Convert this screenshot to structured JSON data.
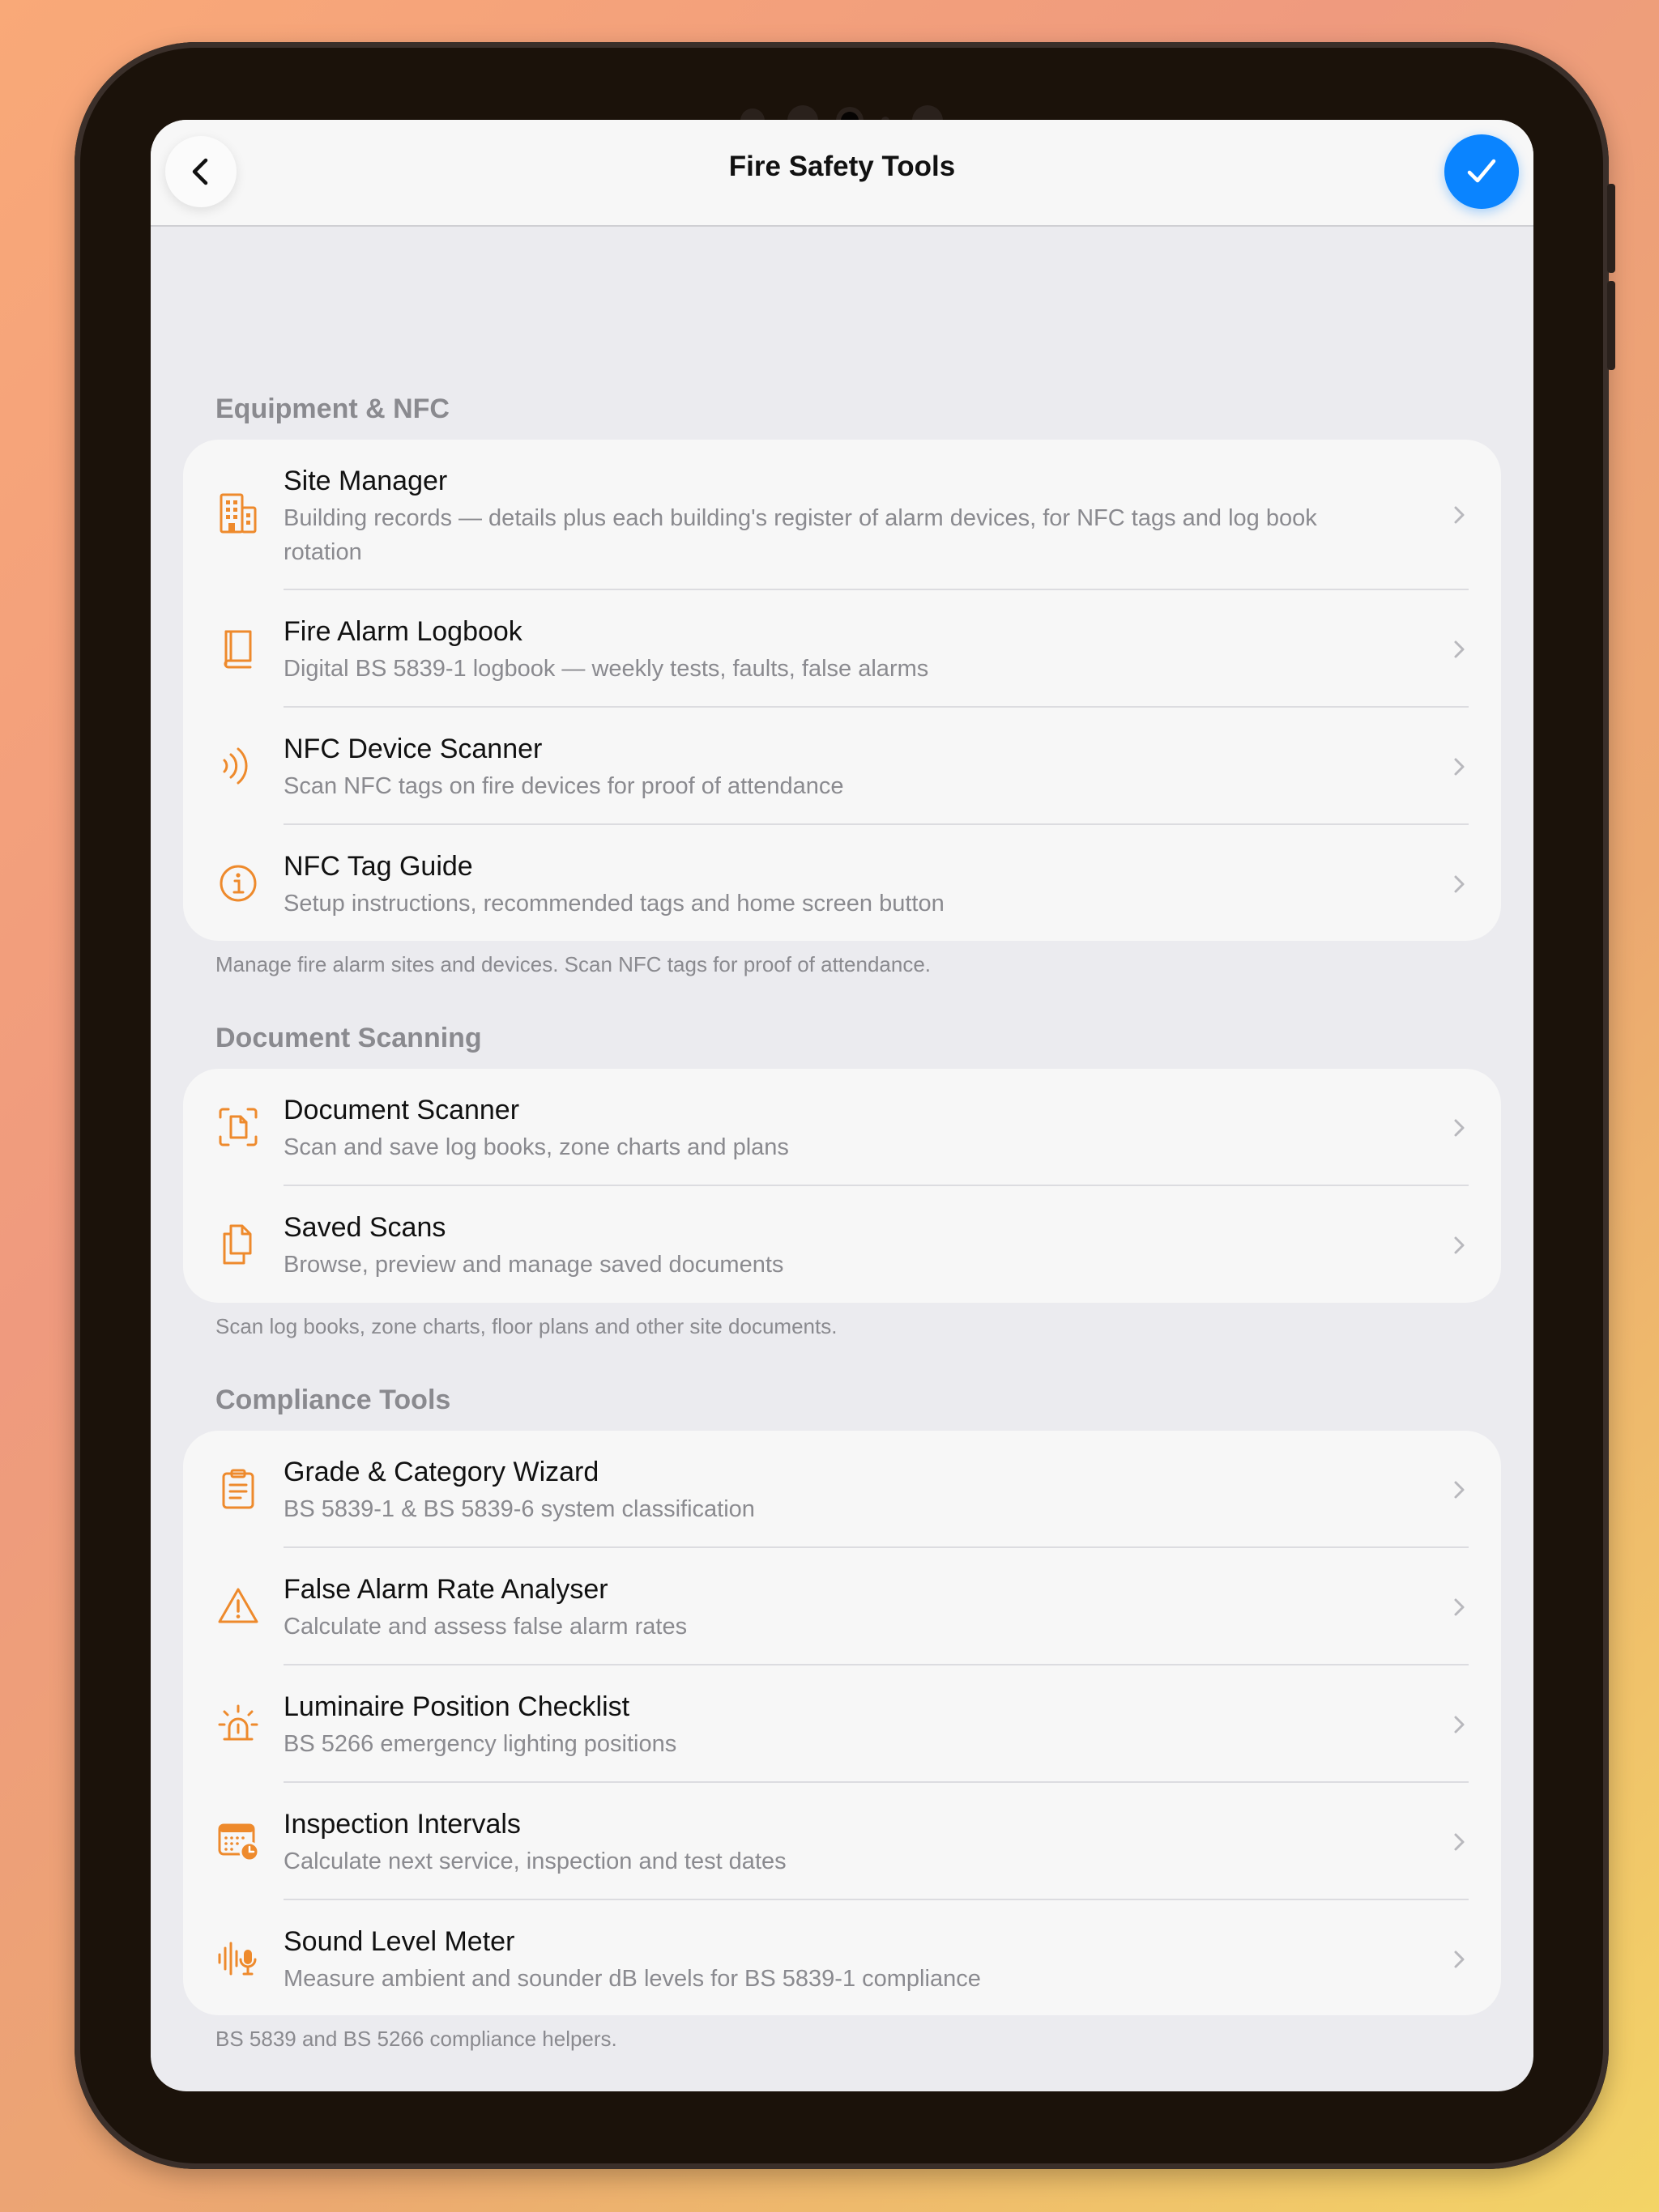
{
  "nav": {
    "title": "Fire Safety Tools",
    "back_icon": "chevron-left-icon",
    "done_icon": "checkmark-icon",
    "accent": "#0a84ff"
  },
  "theme": {
    "icon_color": "#ee8a2c"
  },
  "sections": [
    {
      "header": "Equipment & NFC",
      "footer": "Manage fire alarm sites and devices. Scan NFC tags for proof of attendance.",
      "items": [
        {
          "icon": "building-icon",
          "title": "Site Manager",
          "subtitle": "Building records — details plus each building's register of alarm devices, for NFC tags and log book rotation"
        },
        {
          "icon": "book-icon",
          "title": "Fire Alarm Logbook",
          "subtitle": "Digital BS 5839-1 logbook — weekly tests, faults, false alarms"
        },
        {
          "icon": "nfc-waves-icon",
          "title": "NFC Device Scanner",
          "subtitle": "Scan NFC tags on fire devices for proof of attendance"
        },
        {
          "icon": "info-icon",
          "title": "NFC Tag Guide",
          "subtitle": "Setup instructions, recommended tags and home screen button"
        }
      ]
    },
    {
      "header": "Document Scanning",
      "footer": "Scan log books, zone charts, floor plans and other site documents.",
      "items": [
        {
          "icon": "document-scan-icon",
          "title": "Document Scanner",
          "subtitle": "Scan and save log books, zone charts and plans"
        },
        {
          "icon": "documents-stack-icon",
          "title": "Saved Scans",
          "subtitle": "Browse, preview and manage saved documents"
        }
      ]
    },
    {
      "header": "Compliance Tools",
      "footer": "BS 5839 and BS 5266 compliance helpers.",
      "items": [
        {
          "icon": "clipboard-icon",
          "title": "Grade & Category Wizard",
          "subtitle": "BS 5839-1 & BS 5839-6 system classification"
        },
        {
          "icon": "warning-triangle-icon",
          "title": "False Alarm Rate Analyser",
          "subtitle": "Calculate and assess false alarm rates"
        },
        {
          "icon": "light-beacon-icon",
          "title": "Luminaire Position Checklist",
          "subtitle": "BS 5266 emergency lighting positions"
        },
        {
          "icon": "calendar-clock-icon",
          "title": "Inspection Intervals",
          "subtitle": "Calculate next service, inspection and test dates"
        },
        {
          "icon": "sound-meter-icon",
          "title": "Sound Level Meter",
          "subtitle": "Measure ambient and sounder dB levels for BS 5839-1 compliance"
        }
      ]
    }
  ]
}
